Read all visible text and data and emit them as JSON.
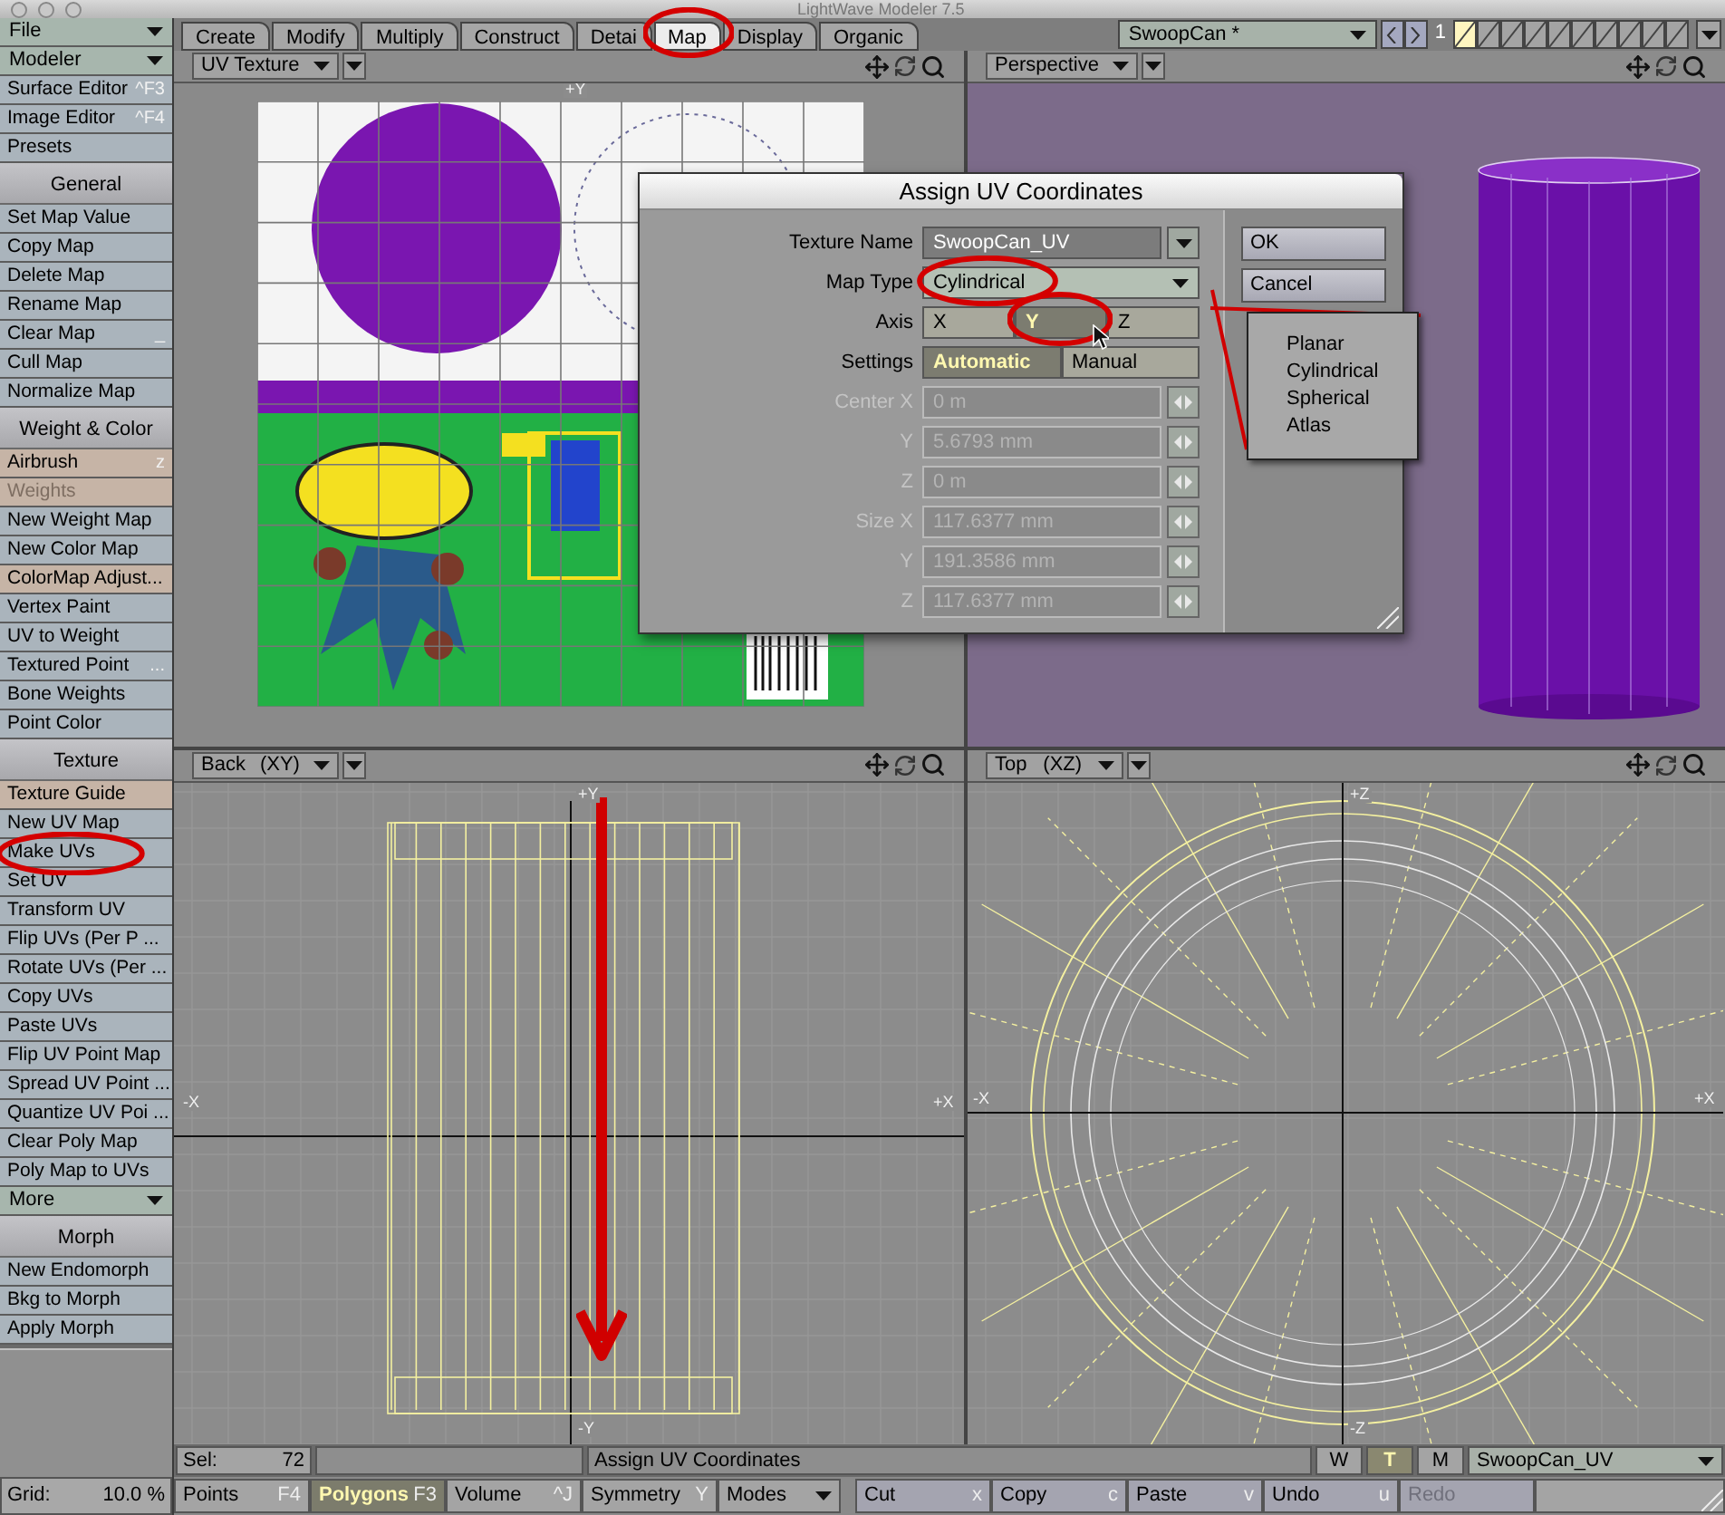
{
  "window": {
    "title": "LightWave Modeler 7.5"
  },
  "sidebar": {
    "items": [
      {
        "kind": "menu",
        "label": "File"
      },
      {
        "kind": "menu",
        "label": "Modeler"
      },
      {
        "kind": "command",
        "label": "Surface Editor",
        "shortcut": "^F3",
        "disabled": false,
        "circled": false
      },
      {
        "kind": "command",
        "label": "Image Editor",
        "shortcut": "^F4",
        "disabled": false,
        "circled": false
      },
      {
        "kind": "command",
        "label": "Presets",
        "disabled": false,
        "circled": false
      },
      {
        "kind": "header",
        "label": "General"
      },
      {
        "kind": "command",
        "label": "Set Map Value",
        "disabled": false,
        "circled": false
      },
      {
        "kind": "command",
        "label": "Copy Map",
        "disabled": false,
        "circled": false
      },
      {
        "kind": "command",
        "label": "Delete Map",
        "disabled": false,
        "circled": false
      },
      {
        "kind": "command",
        "label": "Rename Map",
        "disabled": false,
        "circled": false
      },
      {
        "kind": "command",
        "label": "Clear Map",
        "shortcut": "_",
        "disabled": false,
        "circled": false
      },
      {
        "kind": "command",
        "label": "Cull Map",
        "disabled": false,
        "circled": false
      },
      {
        "kind": "command",
        "label": "Normalize Map",
        "disabled": false,
        "circled": false
      },
      {
        "kind": "header",
        "label": "Weight & Color"
      },
      {
        "kind": "tool",
        "label": "Airbrush",
        "shortcut": "z",
        "disabled": false,
        "circled": false
      },
      {
        "kind": "tool",
        "label": "Weights",
        "disabled": true,
        "circled": false
      },
      {
        "kind": "command",
        "label": "New Weight Map",
        "disabled": false,
        "circled": false
      },
      {
        "kind": "command",
        "label": "New Color Map",
        "disabled": false,
        "circled": false
      },
      {
        "kind": "tool",
        "label": "ColorMap Adjust...",
        "disabled": false,
        "circled": false
      },
      {
        "kind": "command",
        "label": "Vertex Paint",
        "disabled": false,
        "circled": false
      },
      {
        "kind": "command",
        "label": "UV to Weight",
        "disabled": false,
        "circled": false
      },
      {
        "kind": "command",
        "label": "Textured Point",
        "shortcut": "...",
        "disabled": false,
        "circled": false
      },
      {
        "kind": "command",
        "label": "Bone Weights",
        "disabled": false,
        "circled": false
      },
      {
        "kind": "command",
        "label": "Point Color",
        "disabled": false,
        "circled": false
      },
      {
        "kind": "header",
        "label": "Texture"
      },
      {
        "kind": "tool",
        "label": "Texture Guide",
        "disabled": false,
        "circled": false
      },
      {
        "kind": "command",
        "label": "New UV Map",
        "disabled": false,
        "circled": false
      },
      {
        "kind": "command",
        "label": "Make UVs",
        "disabled": false,
        "circled": true
      },
      {
        "kind": "command",
        "label": "Set UV",
        "disabled": false,
        "circled": false
      },
      {
        "kind": "command",
        "label": "Transform UV",
        "disabled": false,
        "circled": false
      },
      {
        "kind": "command",
        "label": "Flip UVs (Per P ...",
        "disabled": false,
        "circled": false
      },
      {
        "kind": "command",
        "label": "Rotate UVs (Per ...",
        "disabled": false,
        "circled": false
      },
      {
        "kind": "command",
        "label": "Copy UVs",
        "disabled": false,
        "circled": false
      },
      {
        "kind": "command",
        "label": "Paste UVs",
        "disabled": false,
        "circled": false
      },
      {
        "kind": "command",
        "label": "Flip UV Point Map",
        "disabled": false,
        "circled": false
      },
      {
        "kind": "command",
        "label": "Spread UV Point ...",
        "disabled": false,
        "circled": false
      },
      {
        "kind": "command",
        "label": "Quantize UV Poi ...",
        "disabled": false,
        "circled": false
      },
      {
        "kind": "command",
        "label": "Clear Poly Map",
        "disabled": false,
        "circled": false
      },
      {
        "kind": "command",
        "label": "Poly Map to UVs",
        "disabled": false,
        "circled": false
      },
      {
        "kind": "menu",
        "label": "More"
      },
      {
        "kind": "header",
        "label": "Morph"
      },
      {
        "kind": "command",
        "label": "New Endomorph",
        "disabled": false,
        "circled": false
      },
      {
        "kind": "command",
        "label": "Bkg to Morph",
        "disabled": false,
        "circled": false
      },
      {
        "kind": "command",
        "label": "Apply Morph",
        "disabled": false,
        "circled": false
      }
    ],
    "grid": {
      "label": "Grid:",
      "value": "10.0 %"
    }
  },
  "tabs": [
    {
      "label": "Create",
      "selected": false,
      "circled": false
    },
    {
      "label": "Modify",
      "selected": false,
      "circled": false
    },
    {
      "label": "Multiply",
      "selected": false,
      "circled": false
    },
    {
      "label": "Construct",
      "selected": false,
      "circled": false
    },
    {
      "label": "Detai",
      "selected": false,
      "circled": false
    },
    {
      "label": "Map",
      "selected": true,
      "circled": true
    },
    {
      "label": "Display",
      "selected": false,
      "circled": false
    },
    {
      "label": "Organic",
      "selected": false,
      "circled": false
    }
  ],
  "object": {
    "value": "SwoopCan *",
    "layer_label": "1",
    "layers": [
      {
        "selected": true
      },
      {
        "selected": false
      },
      {
        "selected": false
      },
      {
        "selected": false
      },
      {
        "selected": false
      },
      {
        "selected": false
      },
      {
        "selected": false
      },
      {
        "selected": false
      },
      {
        "selected": false
      },
      {
        "selected": false
      }
    ]
  },
  "viewports": [
    {
      "kind": "texture",
      "view": "UV Texture",
      "axis_labels": [
        "+Y"
      ]
    },
    {
      "kind": "perspective",
      "view": "Perspective"
    },
    {
      "kind": "front",
      "view": "Back",
      "plane": "(XY)",
      "axis_labels": [
        "+Y",
        "-X",
        "+X",
        "-Y"
      ],
      "annotation_arrow": true
    },
    {
      "kind": "top",
      "view": "Top",
      "plane": "(XZ)",
      "axis_labels": [
        "+Z",
        "-X",
        "+X",
        "-Z"
      ]
    }
  ],
  "dialog": {
    "title": "Assign UV Coordinates",
    "texture_name": {
      "label": "Texture Name",
      "value": "SwoopCan_UV"
    },
    "map_type": {
      "label": "Map Type",
      "value": "Cylindrical",
      "circled": true,
      "expanded": true,
      "options": [
        "Planar",
        "Cylindrical",
        "Spherical",
        "Atlas"
      ]
    },
    "axis": {
      "label": "Axis",
      "options": [
        {
          "label": "X",
          "selected": false,
          "circled": false
        },
        {
          "label": "Y",
          "selected": true,
          "circled": true
        },
        {
          "label": "Z",
          "selected": false,
          "circled": false
        }
      ]
    },
    "settings": {
      "label": "Settings",
      "options": [
        {
          "label": "Automatic",
          "selected": true
        },
        {
          "label": "Manual",
          "selected": false
        }
      ]
    },
    "numeric_fields": [
      {
        "label": "Center X",
        "value": "0 m",
        "disabled": true
      },
      {
        "label": "Y",
        "value": "5.6793 mm",
        "disabled": true
      },
      {
        "label": "Z",
        "value": "0 m",
        "disabled": true
      },
      {
        "label": "Size X",
        "value": "117.6377 mm",
        "disabled": true
      },
      {
        "label": "Y",
        "value": "191.3586 mm",
        "disabled": true
      },
      {
        "label": "Z",
        "value": "117.6377 mm",
        "disabled": true
      }
    ],
    "buttons": [
      "OK",
      "Cancel"
    ]
  },
  "status_bar": {
    "sel_label": "Sel:",
    "sel_value": "72",
    "message": "Assign UV Coordinates",
    "map_modes": [
      {
        "label": "W",
        "selected": false
      },
      {
        "label": "T",
        "selected": true
      },
      {
        "label": "M",
        "selected": false
      }
    ],
    "vertex_map": "SwoopCan_UV"
  },
  "bottom_bar": {
    "selection_modes": [
      {
        "label": "Points",
        "shortcut": "F4",
        "selected": false
      },
      {
        "label": "Polygons",
        "shortcut": "F3",
        "selected": true
      },
      {
        "label": "Volume",
        "shortcut": "^J",
        "selected": false
      }
    ],
    "symmetry": {
      "label": "Symmetry",
      "shortcut": "Y",
      "on": false
    },
    "modes": {
      "label": "Modes"
    },
    "edit_buttons": [
      {
        "label": "Cut",
        "shortcut": "x",
        "disabled": false
      },
      {
        "label": "Copy",
        "shortcut": "c",
        "disabled": false
      },
      {
        "label": "Paste",
        "shortcut": "v",
        "disabled": false
      },
      {
        "label": "Undo",
        "shortcut": "u",
        "disabled": false
      },
      {
        "label": "Redo",
        "disabled": true
      }
    ]
  }
}
